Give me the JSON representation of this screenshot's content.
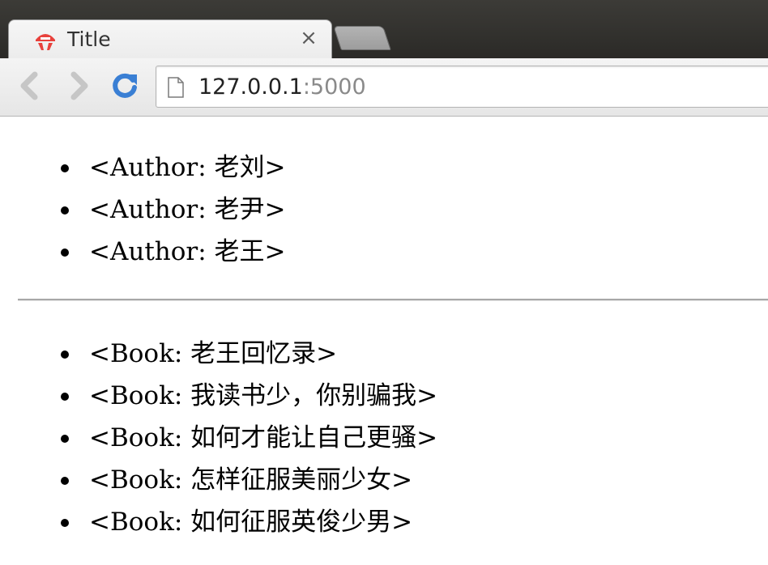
{
  "browser": {
    "tab": {
      "title": "Title",
      "close_symbol": "×",
      "favicon": "flask-icon"
    },
    "toolbar": {
      "back_icon": "chevron-left-icon",
      "forward_icon": "chevron-right-icon",
      "reload_icon": "reload-icon"
    },
    "address_bar": {
      "host": "127.0.0.1",
      "port": ":5000",
      "page_icon": "page-icon"
    }
  },
  "page": {
    "authors": [
      {
        "text": "<Author: 老刘>"
      },
      {
        "text": "<Author: 老尹>"
      },
      {
        "text": "<Author: 老王>"
      }
    ],
    "books": [
      {
        "text": "<Book: 老王回忆录>"
      },
      {
        "text": "<Book: 我读书少，你别骗我>"
      },
      {
        "text": "<Book: 如何才能让自己更骚>"
      },
      {
        "text": "<Book: 怎样征服美丽少女>"
      },
      {
        "text": "<Book: 如何征服英俊少男>"
      }
    ]
  },
  "colors": {
    "titlebar": "#3c3b37",
    "favicon": "#e8413c",
    "reload": "#3a7fd4",
    "url_port": "#8a8a8a"
  }
}
